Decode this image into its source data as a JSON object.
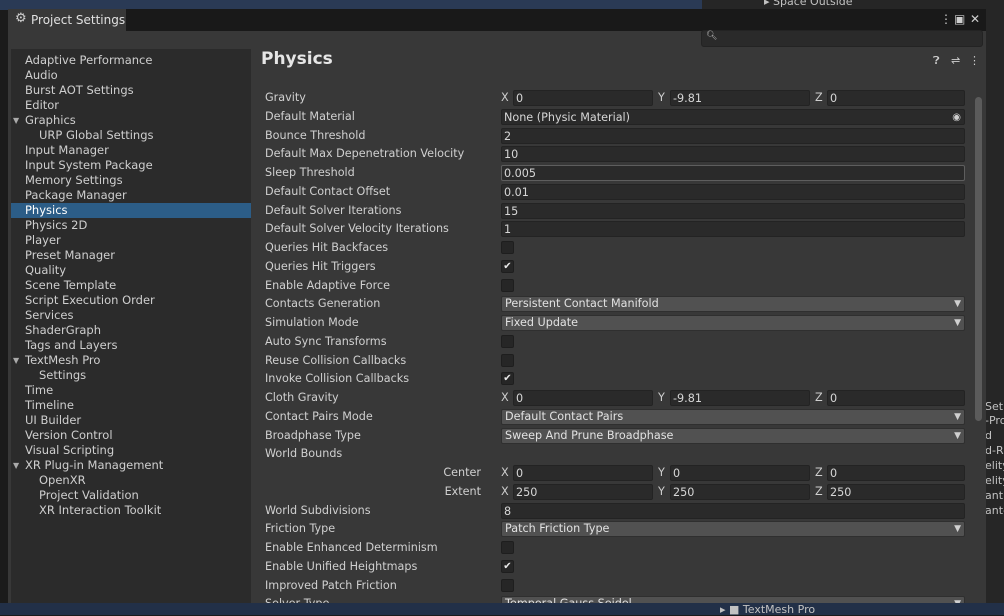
{
  "window": {
    "title": "Project Settings",
    "settings_icon": "gear-icon",
    "menu_icon": "kebab-menu-icon",
    "maximize_icon": "maximize-icon",
    "close_icon": "close-icon"
  },
  "search": {
    "value": "",
    "icon": "search-icon"
  },
  "background": {
    "top_right_item": "Space Outside",
    "bottom_right_item": "TextMesh Pro",
    "right_fragments": [
      "Set",
      "-Pro",
      "d",
      "d-R",
      "elity",
      "elity",
      "ant",
      "ant-"
    ]
  },
  "sidebar": {
    "selected": "Physics",
    "items": [
      {
        "label": "Adaptive Performance",
        "indent": 0
      },
      {
        "label": "Audio",
        "indent": 0
      },
      {
        "label": "Burst AOT Settings",
        "indent": 0
      },
      {
        "label": "Editor",
        "indent": 0
      },
      {
        "label": "Graphics",
        "indent": 0,
        "expanded": true
      },
      {
        "label": "URP Global Settings",
        "indent": 1
      },
      {
        "label": "Input Manager",
        "indent": 0
      },
      {
        "label": "Input System Package",
        "indent": 0
      },
      {
        "label": "Memory Settings",
        "indent": 0
      },
      {
        "label": "Package Manager",
        "indent": 0
      },
      {
        "label": "Physics",
        "indent": 0,
        "selected": true
      },
      {
        "label": "Physics 2D",
        "indent": 0
      },
      {
        "label": "Player",
        "indent": 0
      },
      {
        "label": "Preset Manager",
        "indent": 0
      },
      {
        "label": "Quality",
        "indent": 0
      },
      {
        "label": "Scene Template",
        "indent": 0
      },
      {
        "label": "Script Execution Order",
        "indent": 0
      },
      {
        "label": "Services",
        "indent": 0
      },
      {
        "label": "ShaderGraph",
        "indent": 0
      },
      {
        "label": "Tags and Layers",
        "indent": 0
      },
      {
        "label": "TextMesh Pro",
        "indent": 0,
        "expanded": true
      },
      {
        "label": "Settings",
        "indent": 1
      },
      {
        "label": "Time",
        "indent": 0
      },
      {
        "label": "Timeline",
        "indent": 0
      },
      {
        "label": "UI Builder",
        "indent": 0
      },
      {
        "label": "Version Control",
        "indent": 0
      },
      {
        "label": "Visual Scripting",
        "indent": 0
      },
      {
        "label": "XR Plug-in Management",
        "indent": 0,
        "expanded": true
      },
      {
        "label": "OpenXR",
        "indent": 1
      },
      {
        "label": "Project Validation",
        "indent": 1
      },
      {
        "label": "XR Interaction Toolkit",
        "indent": 1
      }
    ]
  },
  "main": {
    "title": "Physics",
    "header_icons": [
      "help-icon",
      "preset-sliders-icon",
      "kebab-menu-icon"
    ],
    "rows": [
      {
        "label": "Gravity",
        "type": "vector3",
        "x": "0",
        "y": "-9.81",
        "z": "0"
      },
      {
        "label": "Default Material",
        "type": "object",
        "value": "None (Physic Material)"
      },
      {
        "label": "Bounce Threshold",
        "type": "float",
        "value": "2"
      },
      {
        "label": "Default Max Depenetration Velocity",
        "type": "float",
        "value": "10"
      },
      {
        "label": "Sleep Threshold",
        "type": "float",
        "value": "0.005",
        "focused": true
      },
      {
        "label": "Default Contact Offset",
        "type": "float",
        "value": "0.01"
      },
      {
        "label": "Default Solver Iterations",
        "type": "int",
        "value": "15"
      },
      {
        "label": "Default Solver Velocity Iterations",
        "type": "int",
        "value": "1"
      },
      {
        "label": "Queries Hit Backfaces",
        "type": "toggle",
        "checked": false
      },
      {
        "label": "Queries Hit Triggers",
        "type": "toggle",
        "checked": true
      },
      {
        "label": "Enable Adaptive Force",
        "type": "toggle",
        "checked": false
      },
      {
        "label": "Contacts Generation",
        "type": "dropdown",
        "value": "Persistent Contact Manifold"
      },
      {
        "label": "Simulation Mode",
        "type": "dropdown",
        "value": "Fixed Update"
      },
      {
        "label": "Auto Sync Transforms",
        "type": "toggle",
        "checked": false
      },
      {
        "label": "Reuse Collision Callbacks",
        "type": "toggle",
        "checked": false
      },
      {
        "label": "Invoke Collision Callbacks",
        "type": "toggle",
        "checked": true
      },
      {
        "label": "Cloth Gravity",
        "type": "vector3",
        "x": "0",
        "y": "-9.81",
        "z": "0"
      },
      {
        "label": "Contact Pairs Mode",
        "type": "dropdown",
        "value": "Default Contact Pairs"
      },
      {
        "label": "Broadphase Type",
        "type": "dropdown",
        "value": "Sweep And Prune Broadphase"
      },
      {
        "label": "World Bounds",
        "type": "header"
      },
      {
        "label": "Center",
        "type": "vector3",
        "indented": true,
        "x": "0",
        "y": "0",
        "z": "0"
      },
      {
        "label": "Extent",
        "type": "vector3",
        "indented": true,
        "x": "250",
        "y": "250",
        "z": "250"
      },
      {
        "label": "World Subdivisions",
        "type": "int",
        "value": "8"
      },
      {
        "label": "Friction Type",
        "type": "dropdown",
        "value": "Patch Friction Type"
      },
      {
        "label": "Enable Enhanced Determinism",
        "type": "toggle",
        "checked": false
      },
      {
        "label": "Enable Unified Heightmaps",
        "type": "toggle",
        "checked": true
      },
      {
        "label": "Improved Patch Friction",
        "type": "toggle",
        "checked": false
      },
      {
        "label": "Solver Type",
        "type": "dropdown",
        "value": "Temporal Gauss Seidel"
      }
    ]
  },
  "colors": {
    "selection": "#2c5d87",
    "panel": "#383838",
    "sidebar": "#2b2b2b",
    "field": "#2a2a2a",
    "dropdown": "#515151"
  }
}
